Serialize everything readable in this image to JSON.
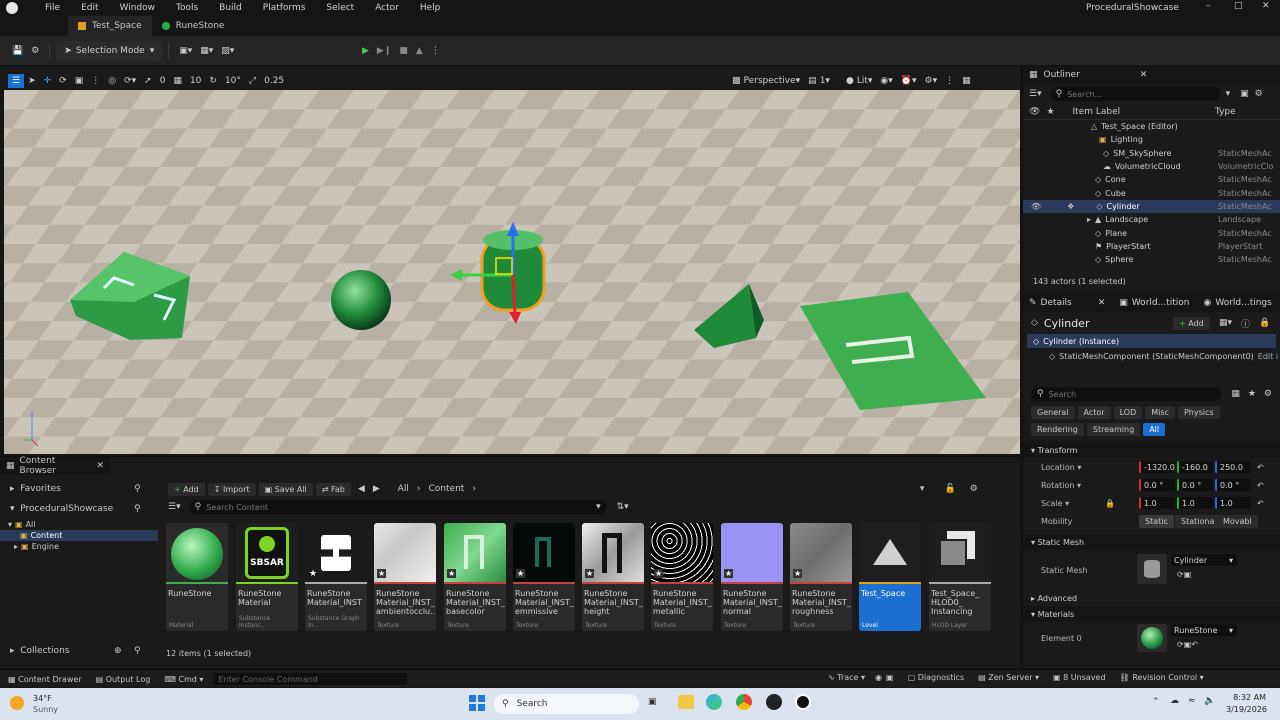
{
  "app": {
    "project_name": "ProceduralShowcase"
  },
  "menu": [
    "File",
    "Edit",
    "Window",
    "Tools",
    "Build",
    "Platforms",
    "Select",
    "Actor",
    "Help"
  ],
  "tabs": [
    {
      "label": "Test_Space"
    },
    {
      "label": "RuneStone"
    }
  ],
  "toolbar": {
    "selection_mode": "Selection Mode"
  },
  "viewport_toolbar": {
    "grid_snap_value": "10",
    "rotation_snap_value": "10°",
    "scale_snap_value": "0.25",
    "move_snap_value": "0",
    "view_mode": "Perspective",
    "camera_speed": "1",
    "lit_mode": "Lit"
  },
  "outliner": {
    "title": "Outliner",
    "search_placeholder": "Search...",
    "col_label": "Item Label",
    "col_type": "Type",
    "items": [
      {
        "label": "Test_Space (Editor)",
        "type": ""
      },
      {
        "label": "Lighting",
        "type": ""
      },
      {
        "label": "SM_SkySphere",
        "type": "StaticMeshAc"
      },
      {
        "label": "VolumetricCloud",
        "type": "VolumetricClo"
      },
      {
        "label": "Cone",
        "type": "StaticMeshAc"
      },
      {
        "label": "Cube",
        "type": "StaticMeshAc"
      },
      {
        "label": "Cylinder",
        "type": "StaticMeshAc"
      },
      {
        "label": "Landscape",
        "type": "Landscape"
      },
      {
        "label": "Plane",
        "type": "StaticMeshAc"
      },
      {
        "label": "PlayerStart",
        "type": "PlayerStart"
      },
      {
        "label": "Sphere",
        "type": "StaticMeshAc"
      }
    ],
    "status": "143 actors (1 selected)"
  },
  "details": {
    "tabs": [
      "Details",
      "World...tition",
      "World...tings"
    ],
    "actor_name": "Cylinder",
    "add_label": "Add",
    "instance_label": "Cylinder (Instance)",
    "component_label": "StaticMeshComponent (StaticMeshComponent0)",
    "edit_label": "Edit i",
    "search_placeholder": "Search",
    "filters": [
      "General",
      "Actor",
      "LOD",
      "Misc",
      "Physics",
      "Rendering",
      "Streaming",
      "All"
    ],
    "transform": {
      "section": "Transform",
      "location_label": "Location",
      "location": [
        "-1320.0",
        "-160.0",
        "250.0"
      ],
      "rotation_label": "Rotation",
      "rotation": [
        "0.0 °",
        "0.0 °",
        "0.0 °"
      ],
      "scale_label": "Scale",
      "scale": [
        "1.0",
        "1.0",
        "1.0"
      ],
      "mobility_label": "Mobility",
      "mobility_options": [
        "Static",
        "Stationa",
        "Movabl"
      ]
    },
    "static_mesh": {
      "section": "Static Mesh",
      "label": "Static Mesh",
      "value": "Cylinder"
    },
    "advanced_label": "Advanced",
    "materials": {
      "section": "Materials",
      "element_label": "Element 0",
      "value": "RuneStone"
    }
  },
  "content_browser": {
    "tab_title": "Content Browser",
    "add_label": "Add",
    "import_label": "Import",
    "save_all_label": "Save All",
    "fab_label": "Fab",
    "path": [
      "All",
      "Content"
    ],
    "search_placeholder": "Search Content",
    "favorites_label": "Favorites",
    "project_label": "ProceduralShowcase",
    "tree": [
      "All",
      "Content",
      "Engine"
    ],
    "collections_label": "Collections",
    "item_count": "12 items (1 selected)",
    "assets": [
      {
        "name": "RuneStone",
        "kind": "Material"
      },
      {
        "name": "RuneStone Material",
        "kind": "Substance Instanc..."
      },
      {
        "name": "RuneStone Material_INST",
        "kind": "Substance Graph In..."
      },
      {
        "name": "RuneStone Material_INST_ ambientocclu...",
        "kind": "Texture"
      },
      {
        "name": "RuneStone Material_INST_ basecolor",
        "kind": "Texture"
      },
      {
        "name": "RuneStone Material_INST_ emmissive",
        "kind": "Texture"
      },
      {
        "name": "RuneStone Material_INST_ height",
        "kind": "Texture"
      },
      {
        "name": "RuneStone Material_INST_ metallic",
        "kind": "Texture"
      },
      {
        "name": "RuneStone Material_INST_ normal",
        "kind": "Texture"
      },
      {
        "name": "RuneStone Material_INST_ roughness",
        "kind": "Texture"
      },
      {
        "name": "Test_Space",
        "kind": "Level"
      },
      {
        "name": "Test_Space_ HLOD0_ Instancing",
        "kind": "HLOD Layer"
      }
    ],
    "sbsar_badge": "SBSAR"
  },
  "statusbar": {
    "content_drawer": "Content Drawer",
    "output_log": "Output Log",
    "cmd": "Cmd",
    "console_placeholder": "Enter Console Command",
    "trace": "Trace",
    "diagnostics": "Diagnostics",
    "zen_server": "Zen Server",
    "unsaved": "8 Unsaved",
    "revision_control": "Revision Control"
  },
  "taskbar": {
    "weather_temp": "34°F",
    "weather_desc": "Sunny",
    "search_label": "Search",
    "time": "8:32 AM",
    "date": "3/19/2026"
  },
  "colors": {
    "accent": "#1a6fd0",
    "selection_row": "#2a3a5a",
    "rune_green": "#2faa4a",
    "sbsar_green": "#7ed321"
  }
}
